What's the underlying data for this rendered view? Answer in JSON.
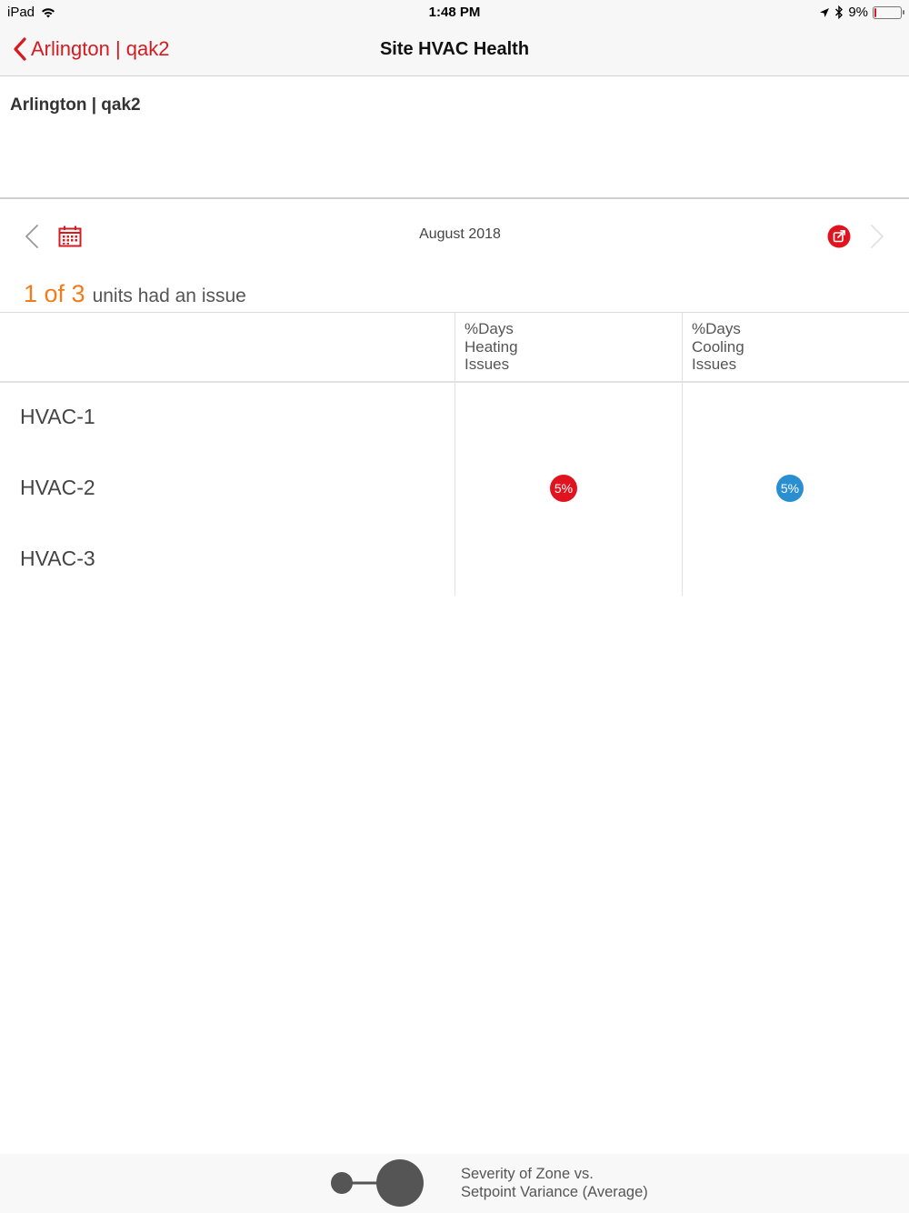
{
  "status_bar": {
    "device": "iPad",
    "time": "1:48 PM",
    "battery_percent": "9%",
    "battery_level": 0.09,
    "icons": [
      "wifi-icon",
      "location-icon",
      "bluetooth-icon",
      "battery-icon"
    ]
  },
  "nav": {
    "back_label": "Arlington | qak2",
    "title": "Site HVAC Health"
  },
  "site": {
    "name": "Arlington | qak2"
  },
  "date_bar": {
    "month": "August 2018",
    "icons": [
      "chevron-left-icon",
      "calendar-icon",
      "share-icon",
      "chevron-right-icon"
    ]
  },
  "summary": {
    "count": "1 of 3",
    "text": "units had an issue"
  },
  "table": {
    "headers": [
      "%Days\nHeating\nIssues",
      "%Days\nCooling\nIssues"
    ],
    "rows": [
      {
        "name": "HVAC-1",
        "heating": "",
        "cooling": ""
      },
      {
        "name": "HVAC-2",
        "heating": "5%",
        "cooling": "5%"
      },
      {
        "name": "HVAC-3",
        "heating": "",
        "cooling": ""
      }
    ]
  },
  "legend": {
    "text_line1": "Severity of Zone vs.",
    "text_line2": "Setpoint Variance (Average)"
  },
  "colors": {
    "accent_red": "#d51a20",
    "heating_badge": "#e0141e",
    "cooling_badge": "#2a8fd0",
    "summary_orange": "#f07c1a"
  }
}
